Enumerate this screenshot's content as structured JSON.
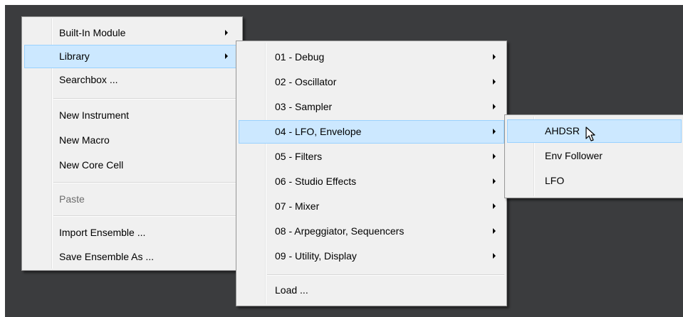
{
  "colors": {
    "background": "#3b3c3e",
    "menu": "#f0f0f0",
    "highlight": "#cce8ff",
    "highlight_border": "#99d1ff",
    "disabled_text": "#6d6d6d"
  },
  "main_menu": {
    "items": [
      {
        "label": "Built-In Module",
        "submenu": true
      },
      {
        "label": "Library",
        "submenu": true,
        "highlighted": true
      },
      {
        "label": "Searchbox ..."
      },
      {
        "label": "New Instrument"
      },
      {
        "label": "New Macro"
      },
      {
        "label": "New Core Cell"
      },
      {
        "label": "Paste",
        "disabled": true
      },
      {
        "label": "Import Ensemble ..."
      },
      {
        "label": "Save Ensemble As ..."
      }
    ]
  },
  "library_menu": {
    "items": [
      {
        "label": "01 - Debug",
        "submenu": true
      },
      {
        "label": "02 - Oscillator",
        "submenu": true
      },
      {
        "label": "03 - Sampler",
        "submenu": true
      },
      {
        "label": "04 - LFO, Envelope",
        "submenu": true,
        "highlighted": true
      },
      {
        "label": "05 - Filters",
        "submenu": true
      },
      {
        "label": "06 - Studio Effects",
        "submenu": true
      },
      {
        "label": "07 - Mixer",
        "submenu": true
      },
      {
        "label": "08 - Arpeggiator, Sequencers",
        "submenu": true
      },
      {
        "label": "09 - Utility, Display",
        "submenu": true
      },
      {
        "label": "Load ..."
      }
    ]
  },
  "lfo_envelope_menu": {
    "items": [
      {
        "label": "AHDSR",
        "highlighted": true
      },
      {
        "label": "Env Follower"
      },
      {
        "label": "LFO"
      }
    ]
  },
  "cursor": {
    "icon": "mouse-pointer-icon"
  }
}
